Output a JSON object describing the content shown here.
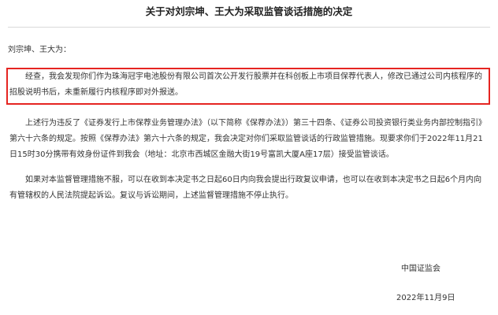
{
  "document": {
    "title": "关于对刘宗坤、王大为采取监管谈话措施的决定",
    "salutation": "刘宗坤、王大为：",
    "paragraphs": [
      "经查，我会发现你们作为珠海冠宇电池股份有限公司首次公开发行股票并在科创板上市项目保荐代表人，修改已通过公司内核程序的招股说明书后，未重新履行内核程序即对外报送。",
      "上述行为违反了《证券发行上市保荐业务管理办法》（以下简称《保荐办法》）第三十四条、《证券公司投资银行类业务内部控制指引》第六十六条的规定。按照《保荐办法》第六十六条的规定，我会决定对你们采取监管谈话的行政监管措施。现要求你们于2022年11月21日15时30分携带有效身份证件到我会（地址：北京市西城区金融大街19号富凯大厦A座17层）接受监管谈话。",
      "如果对本监督管理措施不服，可以在收到本决定书之日起60日内向我会提出行政复议申请，也可以在收到本决定书之日起6个月内向有管辖权的人民法院提起诉讼。复议与诉讼期间，上述监督管理措施不停止执行。"
    ],
    "issuer": "中国证监会",
    "date": "2022年11月9日"
  },
  "colors": {
    "highlight_border": "#e52521",
    "text": "#333333",
    "title": "#222222"
  }
}
